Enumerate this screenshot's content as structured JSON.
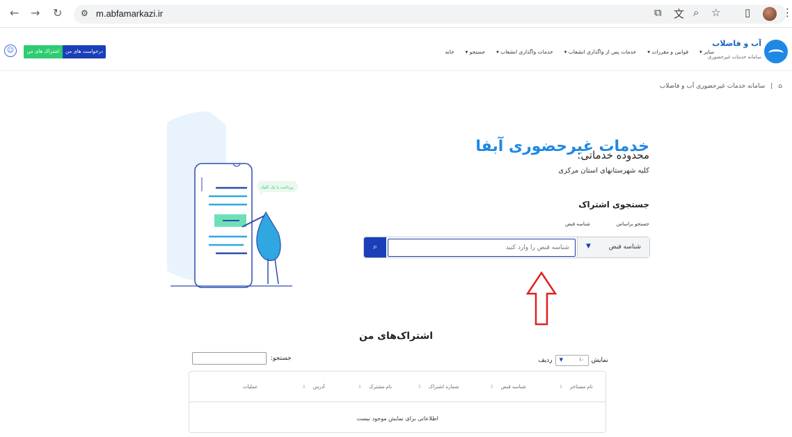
{
  "browser": {
    "url": "m.abfamarkazi.ir"
  },
  "header": {
    "logo_title": "آب و فاضلاب",
    "logo_subtitle": "سامانه خدمات غیرحضوری",
    "menu": [
      "خانه",
      "جستجو ▾",
      "خدمات واگذاری انشعاب ▾",
      "خدمات پس از واگذاری انشعاب ▾",
      "قوانین و مقررات ▾",
      "سایر ▾"
    ],
    "my_subscriptions_button": "اشتراک های من",
    "my_requests_button": "درخواست های من"
  },
  "breadcrumb": {
    "separator": "|",
    "current": "سامانه خدمات غیرحضوری آب و فاضلاب"
  },
  "main": {
    "title": "خدمات غیرحضوری آبفا",
    "service_scope_heading": "محدوده خدماتی:",
    "service_scope_value": "کلیه شهرستانهای استان مرکزی",
    "search_heading": "جستجوی اشتراک",
    "search_by_label": "جستجو براساس",
    "bill_id_label": "شناسه قبض",
    "select_value": "شناسه قبض",
    "input_placeholder": "شناسه قبض را وارد کنید",
    "illustration_text": "پرداخت با یک کلیک"
  },
  "table": {
    "heading": "اشتراک‌های من",
    "show_label": "نمایش",
    "page_size": "۱۰",
    "rows_label": "ردیف",
    "search_label": "جستجو:",
    "columns": [
      "نام مستاجر",
      "شناسه قبض",
      "شماره اشتراک",
      "نام مشترک",
      "آدرس",
      "عملیات"
    ],
    "empty_message": "اطلاعاتی برای نمایش موجود نیست"
  },
  "colors": {
    "primary": "#1a3fb8",
    "accent_blue": "#1e88e5",
    "green": "#2ecc71",
    "annotation_arrow": "#e02020"
  }
}
